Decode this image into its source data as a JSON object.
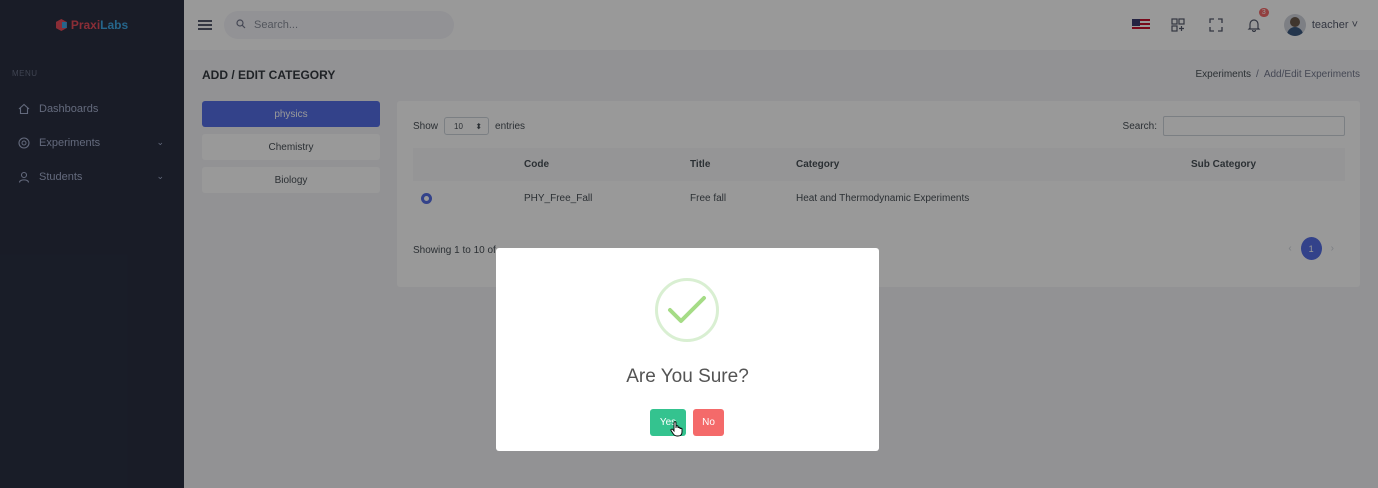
{
  "app": {
    "logo_primary": "Praxi",
    "logo_secondary": "Labs"
  },
  "sidebar": {
    "menu_title": "MENU",
    "items": [
      {
        "label": "Dashboards",
        "icon": "home-icon"
      },
      {
        "label": "Experiments",
        "icon": "flask-icon",
        "expandable": true
      },
      {
        "label": "Students",
        "icon": "user-icon",
        "expandable": true
      }
    ]
  },
  "topbar": {
    "search_placeholder": "Search...",
    "notification_count": "3",
    "user_name": "teacher"
  },
  "page": {
    "title": "ADD / EDIT CATEGORY",
    "breadcrumb": [
      "Experiments",
      "Add/Edit Experiments"
    ]
  },
  "categories": [
    {
      "label": "physics",
      "active": true
    },
    {
      "label": "Chemistry",
      "active": false
    },
    {
      "label": "Biology",
      "active": false
    }
  ],
  "table": {
    "show_label": "Show",
    "entries_value": "10",
    "entries_label": "entries",
    "search_label": "Search:",
    "columns": [
      "",
      "Code",
      "Title",
      "Category",
      "Sub Category"
    ],
    "rows": [
      {
        "selected": true,
        "code": "PHY_Free_Fall",
        "title": "Free fall",
        "category": "Heat and Thermodynamic Experiments",
        "sub_category": ""
      }
    ],
    "showing_text": "Showing 1 to 10 of",
    "pagination": {
      "prev": "‹",
      "current": "1",
      "next": "›"
    }
  },
  "modal": {
    "title": "Are You Sure?",
    "yes_label": "Yes",
    "no_label": "No"
  },
  "colors": {
    "sidebar_bg": "#2a3042",
    "primary": "#556ee6",
    "success": "#34c38f",
    "danger": "#f46a6a"
  }
}
